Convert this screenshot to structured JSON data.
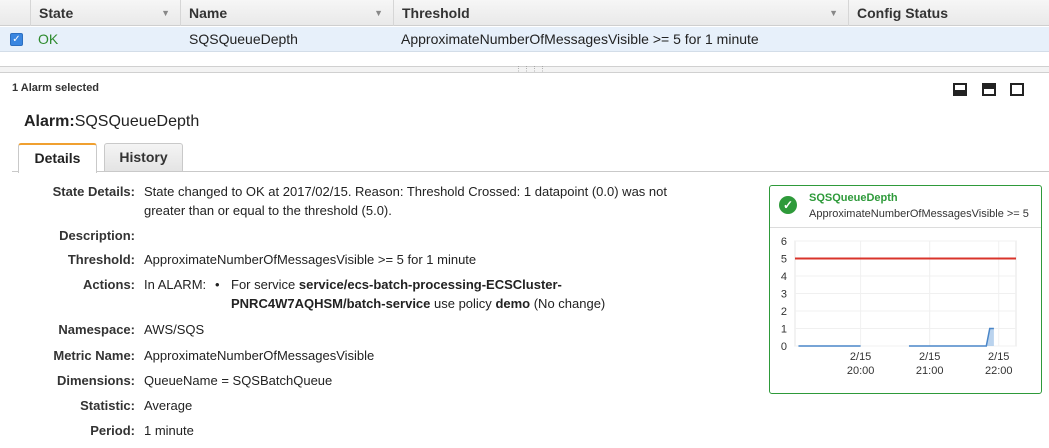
{
  "table": {
    "columns": [
      {
        "label": "State"
      },
      {
        "label": "Name"
      },
      {
        "label": "Threshold"
      },
      {
        "label": "Config Status"
      }
    ],
    "selected_row": {
      "checked": true,
      "state": "OK",
      "name": "SQSQueueDepth",
      "threshold": "ApproximateNumberOfMessagesVisible >= 5 for 1 minute",
      "config_status": ""
    }
  },
  "detail": {
    "selection_count": "1 Alarm selected",
    "alarm_prefix": "Alarm:",
    "alarm_name": "SQSQueueDepth",
    "tabs": [
      {
        "label": "Details",
        "active": true
      },
      {
        "label": "History",
        "active": false
      }
    ],
    "fields": {
      "state_details_label": "State Details:",
      "state_details_line1": "State changed to OK at 2017/02/15. Reason: Threshold Crossed: 1 datapoint (0.0) was not",
      "state_details_line2": "greater than or equal to the threshold (5.0).",
      "description_label": "Description:",
      "description_value": "",
      "threshold_label": "Threshold:",
      "threshold_value": "ApproximateNumberOfMessagesVisible >= 5 for 1 minute",
      "actions_label": "Actions:",
      "actions_in_alarm": "In ALARM:",
      "actions_bullet": "•",
      "actions_line1_pre": "For service ",
      "actions_line1_bold": "service/ecs-batch-processing-ECSCluster-",
      "actions_line2_bold": "PNRC4W7AQHSM/batch-service",
      "actions_line2_mid": " use policy ",
      "actions_line2_policy": "demo",
      "actions_line2_post": " (No change)",
      "namespace_label": "Namespace:",
      "namespace_value": "AWS/SQS",
      "metric_label": "Metric Name:",
      "metric_value": "ApproximateNumberOfMessagesVisible",
      "dimensions_label": "Dimensions:",
      "dimensions_value": "QueueName = SQSBatchQueue",
      "statistic_label": "Statistic:",
      "statistic_value": "Average",
      "period_label": "Period:",
      "period_value": "1 minute"
    }
  },
  "widget": {
    "title": "SQSQueueDepth",
    "subtitle": "ApproximateNumberOfMessagesVisible >= 5",
    "status_icon": "check-icon",
    "colors": {
      "border": "#2e9a3a",
      "threshold": "#d9342b",
      "series": "#4a86c8"
    }
  },
  "chart_data": {
    "type": "line",
    "title": "SQSQueueDepth",
    "ylim": [
      0,
      6
    ],
    "yticks": [
      "0",
      "1",
      "2",
      "3",
      "4",
      "5",
      "6"
    ],
    "xticks": [
      {
        "date": "2/15",
        "time": "20:00",
        "hour": 20
      },
      {
        "date": "2/15",
        "time": "21:00",
        "hour": 21
      },
      {
        "date": "2/15",
        "time": "22:00",
        "hour": 22
      }
    ],
    "threshold": 5,
    "series": [
      {
        "x": [
          19.1,
          20.0
        ],
        "y": [
          0,
          0
        ]
      },
      {
        "x": [
          20.7,
          21.0,
          21.55,
          21.82,
          21.87,
          21.93
        ],
        "y": [
          0,
          0,
          0,
          0,
          1,
          1
        ]
      }
    ],
    "grid": true
  }
}
